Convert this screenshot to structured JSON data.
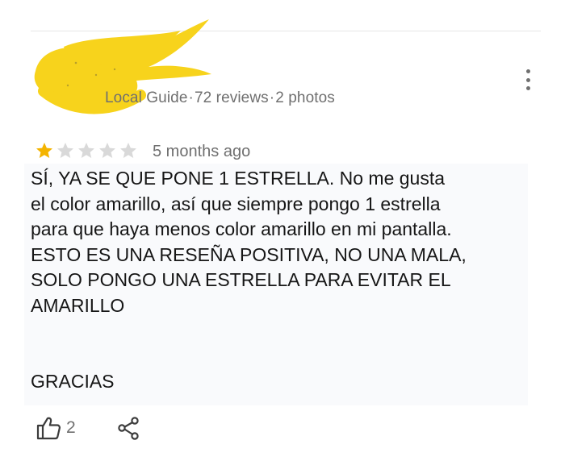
{
  "reviewer": {
    "meta_parts": [
      "Local Guide",
      "72 reviews",
      "2 photos"
    ],
    "separator": "·"
  },
  "rating": {
    "value": 1,
    "max": 5,
    "filled_color": "#f4b400",
    "empty_color": "#d9d9d9"
  },
  "time_ago": "5 months ago",
  "review_text": "SÍ, YA SE QUE PONE 1 ESTRELLA. No me gusta\nel color amarillo, así que siempre pongo 1 estrella\npara que haya menos color amarillo en mi pantalla.\nESTO ES UNA RESEÑA POSITIVA, NO UNA MALA,\nSOLO PONGO UNA ESTRELLA PARA EVITAR EL\nAMARILLO",
  "thanks": "GRACIAS",
  "actions": {
    "like_count": "2",
    "like_icon": "thumbs-up-icon",
    "share_icon": "share-icon",
    "more_icon": "more-vert-icon"
  },
  "colors": {
    "scribble": "#f7d31c",
    "meta_text": "#6f6f6f"
  }
}
